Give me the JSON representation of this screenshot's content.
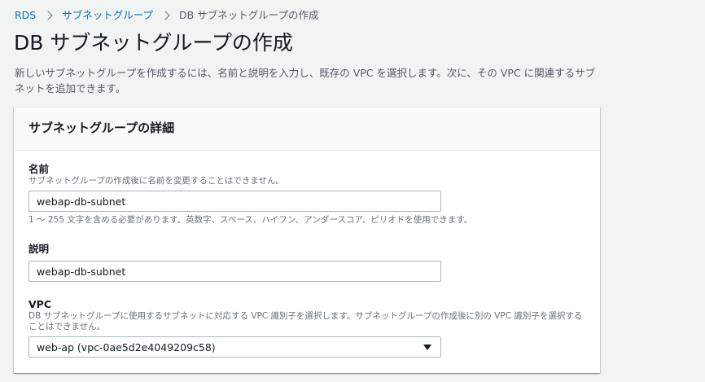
{
  "breadcrumb": {
    "items": [
      "RDS",
      "サブネットグループ"
    ],
    "current": "DB サブネットグループの作成"
  },
  "page": {
    "title": "DB サブネットグループの作成",
    "description": "新しいサブネットグループを作成するには、名前と説明を入力し、既存の VPC を選択します。次に、その VPC に関連するサブネットを追加できます。"
  },
  "panel": {
    "title": "サブネットグループの詳細"
  },
  "fields": {
    "name": {
      "label": "名前",
      "description": "サブネットグループの作成後に名前を変更することはできません。",
      "value": "webap-db-subnet",
      "constraint": "1 ～ 255 文字を含める必要があります。英数字、スペース、ハイフン、アンダースコア、ピリオドを使用できます。"
    },
    "description": {
      "label": "説明",
      "value": "webap-db-subnet"
    },
    "vpc": {
      "label": "VPC",
      "description": "DB サブネットグループに使用するサブネットに対応する VPC 識別子を選択します。サブネットグループの作成後に別の VPC 識別子を選択することはできません。",
      "selected": "web-ap (vpc-0ae5d2e4049209c58)"
    }
  },
  "colors": {
    "link": "#0073bb",
    "background": "#f2f3f3",
    "border": "#aab7b8"
  }
}
